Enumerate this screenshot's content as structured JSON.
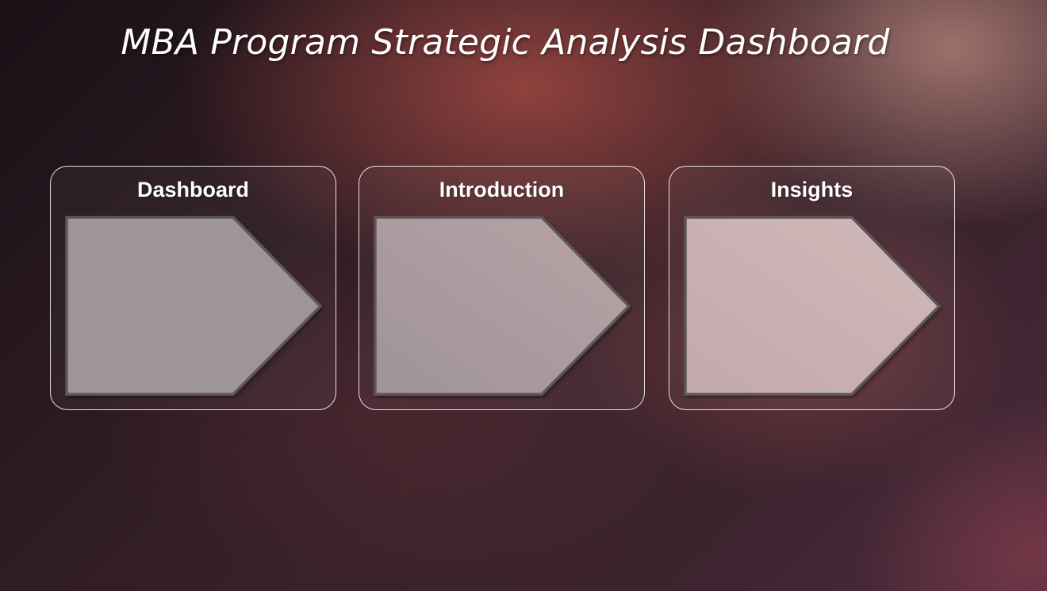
{
  "page": {
    "title": "MBA Program Strategic Analysis Dashboard"
  },
  "cards": [
    {
      "label": "Dashboard",
      "arrow_color": "#9e9599"
    },
    {
      "label": "Introduction",
      "arrow_color": "#a9989e"
    },
    {
      "label": "Insights",
      "arrow_color": "#c9aeb0"
    }
  ],
  "colors": {
    "arrow_border": "#5e5758",
    "card_border": "#ffffff",
    "title_text": "#ffffff"
  }
}
